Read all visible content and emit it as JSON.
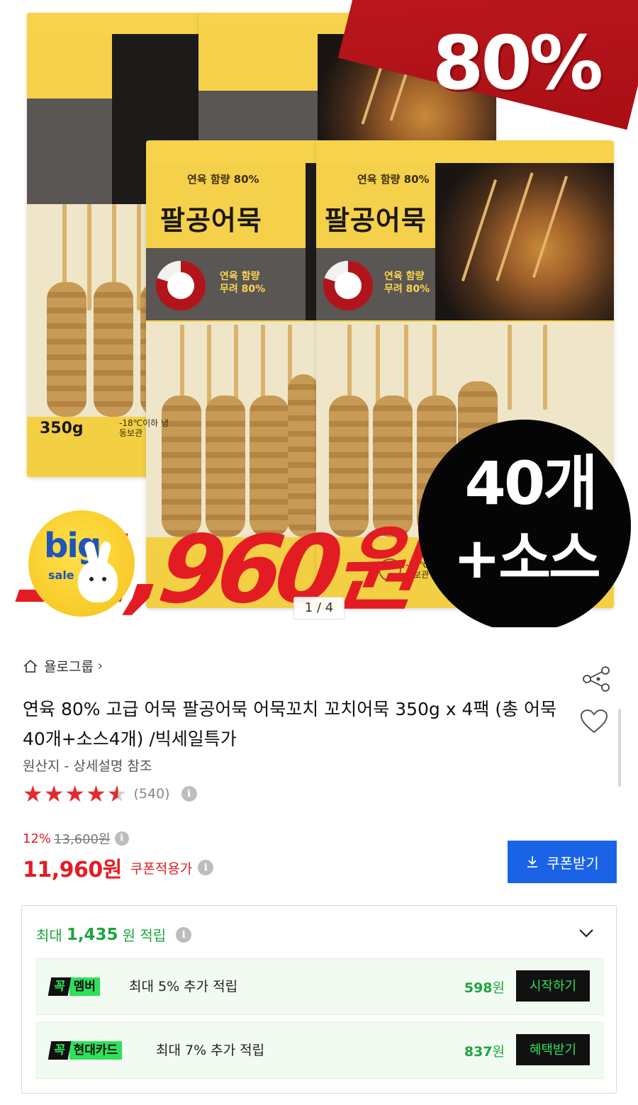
{
  "hero": {
    "pack_brand_small": "연육 함량 80%",
    "pack_name": "팔공어묵",
    "pack_badge_line1": "연육 함량",
    "pack_badge_line2": "무려 80%",
    "pack_weight": "350g",
    "pack_frozen": "-18℃이하 냉동보관",
    "promo_percent": "80%",
    "promo_price": "11,960원",
    "promo_count_line1": "40개",
    "promo_count_line2": "+소스",
    "big_sale_big": "big",
    "big_sale_sale": "sale",
    "pager": "1 / 4"
  },
  "seller": {
    "name": "욜로그룹",
    "chevron": "›"
  },
  "product": {
    "title": "연육 80% 고급 어묵 팔공어묵 어묵꼬치 꼬치어묵 350g x 4팩 (총 어묵40개+소스4개) /빅세일특가",
    "origin": "원산지 - 상세설명 참조",
    "rating": 4.5,
    "review_count": "(540)"
  },
  "pricing": {
    "discount_rate": "12%",
    "original_price": "13,600원",
    "price": "11,960원",
    "price_label": "쿠폰적용가",
    "coupon_button": "쿠폰받기"
  },
  "rewards": {
    "prefix": "최대",
    "amount": "1,435",
    "suffix": "원 적립",
    "rows": [
      {
        "tag_k": "꼭",
        "tag_t": "멤버",
        "desc": "최대 5% 추가 적립",
        "points": "598",
        "won": "원",
        "action": "시작하기"
      },
      {
        "tag_k": "꼭",
        "tag_t": "현대카드",
        "desc": "최대 7% 추가 적립",
        "points": "837",
        "won": "원",
        "action": "혜택받기"
      }
    ]
  },
  "icons": {
    "home": "home-icon",
    "share": "share-icon",
    "heart": "heart-icon",
    "info": "info-icon",
    "download": "download-icon",
    "chevron": "chevron-down-icon"
  },
  "colors": {
    "accent_red": "#e31c24",
    "reward_green": "#1ea53e",
    "tag_green": "#2fe05a",
    "coupon_blue": "#1a63e6",
    "star_red": "#e42b2b"
  }
}
